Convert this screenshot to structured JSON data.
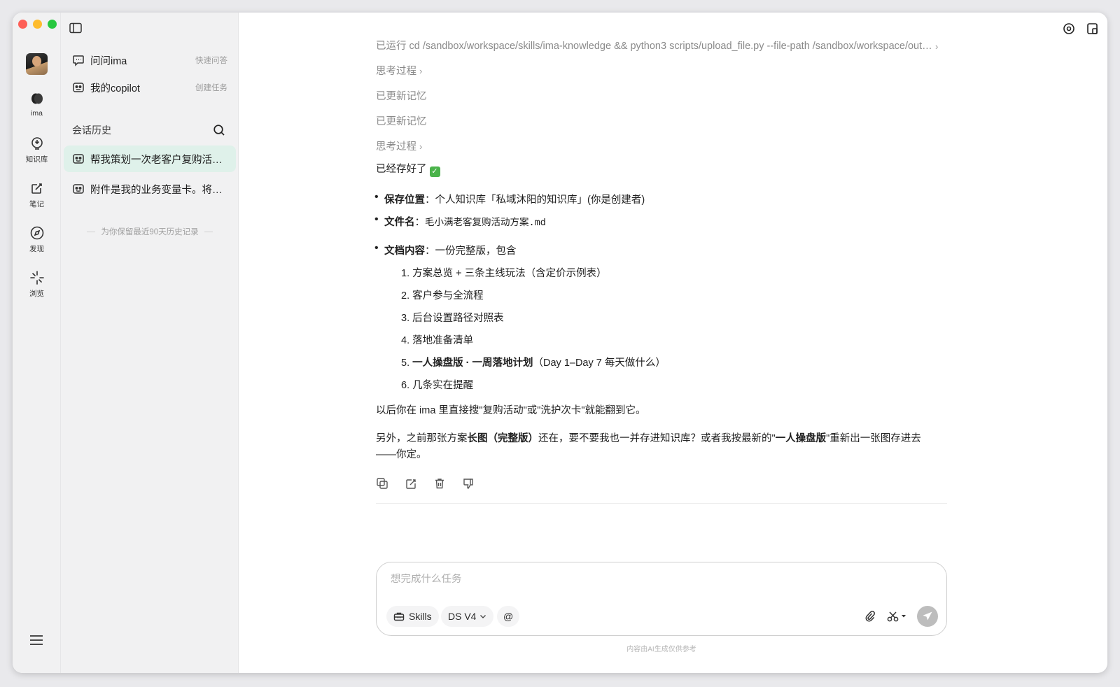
{
  "rail": {
    "items": [
      {
        "label": "ima",
        "icon": "ima-logo-icon"
      },
      {
        "label": "知识库",
        "icon": "knowledge-base-icon"
      },
      {
        "label": "笔记",
        "icon": "note-icon"
      },
      {
        "label": "发现",
        "icon": "compass-icon"
      },
      {
        "label": "浏览",
        "icon": "browse-icon"
      }
    ]
  },
  "sidebar": {
    "top_items": [
      {
        "label": "问问ima",
        "hint": "快速问答"
      },
      {
        "label": "我的copilot",
        "hint": "创建任务"
      }
    ],
    "history_title": "会话历史",
    "chats": [
      {
        "title": "帮我策划一次老客户复购活动，给出完整方案",
        "active": true
      },
      {
        "title": "附件是我的业务变量卡。将它整理成表格",
        "active": false
      }
    ],
    "retention_note": "为你保留最近90天历史记录"
  },
  "conversation": {
    "steps": {
      "run_cmd": "已运行 cd /sandbox/workspace/skills/ima-knowledge && python3 scripts/upload_file.py --file-path /sandbox/workspace/outputs",
      "think1": "思考过程",
      "mem1": "已更新记忆",
      "mem2": "已更新记忆",
      "think2": "思考过程"
    },
    "saved_text": "已经存好了",
    "saved_emoji": "✓",
    "bullets": {
      "location_label": "保存位置",
      "location_value": "：个人知识库「私域沐阳的知识库」(你是创建者)",
      "filename_label": "文件名",
      "filename_sep": "：",
      "filename_value": "毛小满老客复购活动方案.md",
      "content_label": "文档内容",
      "content_value": "：一份完整版，包含"
    },
    "numbered": [
      {
        "n": "1.",
        "text": "方案总览 + 三条主线玩法（含定价示例表）"
      },
      {
        "n": "2.",
        "text": "客户参与全流程"
      },
      {
        "n": "3.",
        "text": "后台设置路径对照表"
      },
      {
        "n": "4.",
        "text": "落地准备清单"
      },
      {
        "n": "5.",
        "bold": "一人操盘版 · 一周落地计划",
        "text": "（Day 1–Day 7 每天做什么）"
      },
      {
        "n": "6.",
        "text": "几条实在提醒"
      }
    ],
    "search_tip": "以后你在 ima 里直接搜\"复购活动\"或\"洗护次卡\"就能翻到它。",
    "followup": {
      "p1": "另外，之前那张方案",
      "b1": "长图（完整版）",
      "p2": "还在，要不要我也一并存进知识库？或者我按最新的\"",
      "b2": "一人操盘版",
      "p3": "\"重新出一张图存进去",
      "line2": "——你定。"
    }
  },
  "composer": {
    "placeholder": "想完成什么任务",
    "skills_label": "Skills",
    "model_label": "DS V4",
    "mention_label": "@"
  },
  "disclaimer": "内容由AI生成仅供参考",
  "colors": {
    "active_chat_bg": "#dff1ea",
    "check_green": "#4ab34a",
    "send_disabled": "#bdbdbd"
  }
}
